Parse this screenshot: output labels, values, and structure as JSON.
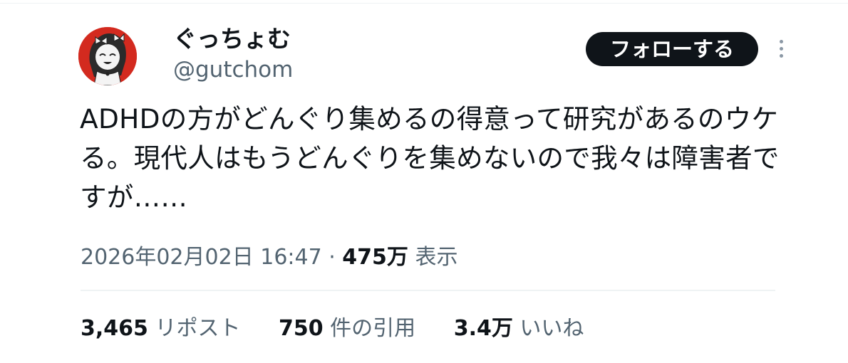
{
  "author": {
    "display_name": "ぐっちょむ",
    "handle": "@gutchom"
  },
  "follow_button": {
    "label": "フォローする"
  },
  "more_menu": {
    "icon": "vertical-ellipsis-icon"
  },
  "tweet": {
    "text": "ADHDの方がどんぐり集めるの得意って研究があるのウケる。現代人はもうどんぐりを集めないので我々は障害者ですが……"
  },
  "meta": {
    "datetime": "2026年02月02日 16:47",
    "separator": " · ",
    "views_count": "475万",
    "views_label": " 表示"
  },
  "stats": {
    "reposts": {
      "count": "3,465",
      "label": " リポスト"
    },
    "quotes": {
      "count": "750",
      "label": " 件の引用"
    },
    "likes": {
      "count": "3.4万",
      "label": " いいね"
    }
  },
  "colors": {
    "text_primary": "#0f1419",
    "text_secondary": "#536471",
    "follow_bg": "#0f1419",
    "follow_text": "#ffffff",
    "divider": "#eff3f4",
    "avatar_bg": "#d32a1f"
  }
}
